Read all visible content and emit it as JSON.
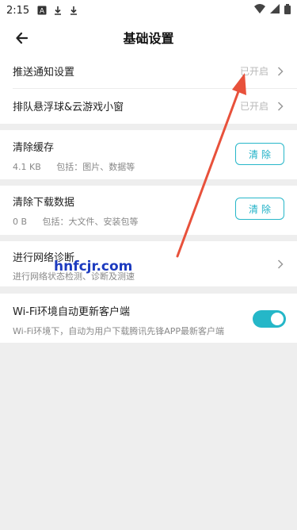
{
  "status_bar": {
    "time": "2:15",
    "icons": [
      "a-icon",
      "download-icon",
      "download-icon",
      "wifi-icon",
      "signal-icon",
      "battery-icon"
    ]
  },
  "header": {
    "title": "基础设置"
  },
  "push": {
    "label": "推送通知设置",
    "value": "已开启"
  },
  "float": {
    "label": "排队悬浮球&云游戏小窗",
    "value": "已开启"
  },
  "cache": {
    "label": "清除缓存",
    "size": "4.1 KB",
    "detail": "包括：图片、数据等",
    "button": "清除"
  },
  "download": {
    "label": "清除下载数据",
    "size": "0 B",
    "detail": "包括：大文件、安装包等",
    "button": "清除"
  },
  "network": {
    "label": "进行网络诊断",
    "detail": "进行网络状态检测、诊断及测速"
  },
  "wifi_update": {
    "label": "Wi-Fi环境自动更新客户端",
    "detail": "Wi-Fi环境下，自动为用户下载腾讯先锋APP最新客户端",
    "enabled": true
  },
  "watermark": "hnfcjr.com",
  "colors": {
    "accent": "#25b7c8",
    "annotation_arrow": "#e8513b",
    "watermark": "#1d3bbf"
  }
}
